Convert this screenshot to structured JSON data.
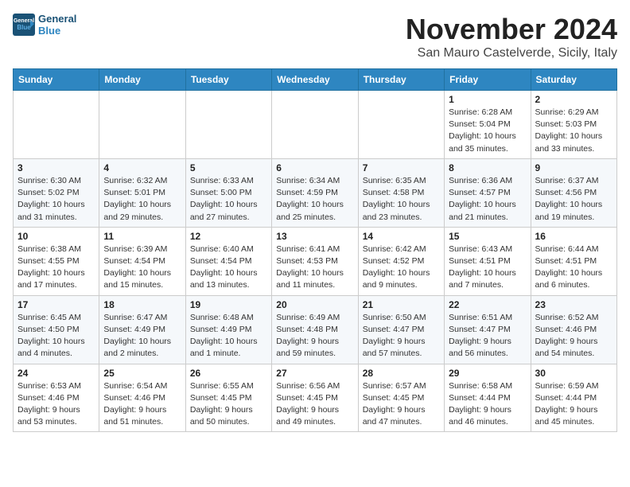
{
  "header": {
    "logo_line1": "General",
    "logo_line2": "Blue",
    "month": "November 2024",
    "location": "San Mauro Castelverde, Sicily, Italy"
  },
  "weekdays": [
    "Sunday",
    "Monday",
    "Tuesday",
    "Wednesday",
    "Thursday",
    "Friday",
    "Saturday"
  ],
  "weeks": [
    [
      {
        "day": "",
        "info": ""
      },
      {
        "day": "",
        "info": ""
      },
      {
        "day": "",
        "info": ""
      },
      {
        "day": "",
        "info": ""
      },
      {
        "day": "",
        "info": ""
      },
      {
        "day": "1",
        "info": "Sunrise: 6:28 AM\nSunset: 5:04 PM\nDaylight: 10 hours\nand 35 minutes."
      },
      {
        "day": "2",
        "info": "Sunrise: 6:29 AM\nSunset: 5:03 PM\nDaylight: 10 hours\nand 33 minutes."
      }
    ],
    [
      {
        "day": "3",
        "info": "Sunrise: 6:30 AM\nSunset: 5:02 PM\nDaylight: 10 hours\nand 31 minutes."
      },
      {
        "day": "4",
        "info": "Sunrise: 6:32 AM\nSunset: 5:01 PM\nDaylight: 10 hours\nand 29 minutes."
      },
      {
        "day": "5",
        "info": "Sunrise: 6:33 AM\nSunset: 5:00 PM\nDaylight: 10 hours\nand 27 minutes."
      },
      {
        "day": "6",
        "info": "Sunrise: 6:34 AM\nSunset: 4:59 PM\nDaylight: 10 hours\nand 25 minutes."
      },
      {
        "day": "7",
        "info": "Sunrise: 6:35 AM\nSunset: 4:58 PM\nDaylight: 10 hours\nand 23 minutes."
      },
      {
        "day": "8",
        "info": "Sunrise: 6:36 AM\nSunset: 4:57 PM\nDaylight: 10 hours\nand 21 minutes."
      },
      {
        "day": "9",
        "info": "Sunrise: 6:37 AM\nSunset: 4:56 PM\nDaylight: 10 hours\nand 19 minutes."
      }
    ],
    [
      {
        "day": "10",
        "info": "Sunrise: 6:38 AM\nSunset: 4:55 PM\nDaylight: 10 hours\nand 17 minutes."
      },
      {
        "day": "11",
        "info": "Sunrise: 6:39 AM\nSunset: 4:54 PM\nDaylight: 10 hours\nand 15 minutes."
      },
      {
        "day": "12",
        "info": "Sunrise: 6:40 AM\nSunset: 4:54 PM\nDaylight: 10 hours\nand 13 minutes."
      },
      {
        "day": "13",
        "info": "Sunrise: 6:41 AM\nSunset: 4:53 PM\nDaylight: 10 hours\nand 11 minutes."
      },
      {
        "day": "14",
        "info": "Sunrise: 6:42 AM\nSunset: 4:52 PM\nDaylight: 10 hours\nand 9 minutes."
      },
      {
        "day": "15",
        "info": "Sunrise: 6:43 AM\nSunset: 4:51 PM\nDaylight: 10 hours\nand 7 minutes."
      },
      {
        "day": "16",
        "info": "Sunrise: 6:44 AM\nSunset: 4:51 PM\nDaylight: 10 hours\nand 6 minutes."
      }
    ],
    [
      {
        "day": "17",
        "info": "Sunrise: 6:45 AM\nSunset: 4:50 PM\nDaylight: 10 hours\nand 4 minutes."
      },
      {
        "day": "18",
        "info": "Sunrise: 6:47 AM\nSunset: 4:49 PM\nDaylight: 10 hours\nand 2 minutes."
      },
      {
        "day": "19",
        "info": "Sunrise: 6:48 AM\nSunset: 4:49 PM\nDaylight: 10 hours\nand 1 minute."
      },
      {
        "day": "20",
        "info": "Sunrise: 6:49 AM\nSunset: 4:48 PM\nDaylight: 9 hours\nand 59 minutes."
      },
      {
        "day": "21",
        "info": "Sunrise: 6:50 AM\nSunset: 4:47 PM\nDaylight: 9 hours\nand 57 minutes."
      },
      {
        "day": "22",
        "info": "Sunrise: 6:51 AM\nSunset: 4:47 PM\nDaylight: 9 hours\nand 56 minutes."
      },
      {
        "day": "23",
        "info": "Sunrise: 6:52 AM\nSunset: 4:46 PM\nDaylight: 9 hours\nand 54 minutes."
      }
    ],
    [
      {
        "day": "24",
        "info": "Sunrise: 6:53 AM\nSunset: 4:46 PM\nDaylight: 9 hours\nand 53 minutes."
      },
      {
        "day": "25",
        "info": "Sunrise: 6:54 AM\nSunset: 4:46 PM\nDaylight: 9 hours\nand 51 minutes."
      },
      {
        "day": "26",
        "info": "Sunrise: 6:55 AM\nSunset: 4:45 PM\nDaylight: 9 hours\nand 50 minutes."
      },
      {
        "day": "27",
        "info": "Sunrise: 6:56 AM\nSunset: 4:45 PM\nDaylight: 9 hours\nand 49 minutes."
      },
      {
        "day": "28",
        "info": "Sunrise: 6:57 AM\nSunset: 4:45 PM\nDaylight: 9 hours\nand 47 minutes."
      },
      {
        "day": "29",
        "info": "Sunrise: 6:58 AM\nSunset: 4:44 PM\nDaylight: 9 hours\nand 46 minutes."
      },
      {
        "day": "30",
        "info": "Sunrise: 6:59 AM\nSunset: 4:44 PM\nDaylight: 9 hours\nand 45 minutes."
      }
    ]
  ]
}
